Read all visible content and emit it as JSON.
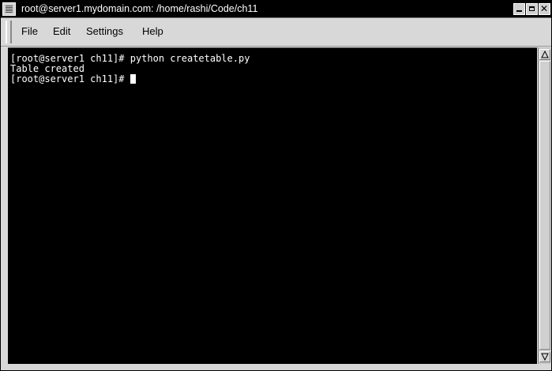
{
  "window": {
    "title": "root@server1.mydomain.com: /home/rashi/Code/ch11",
    "buttons": {
      "minimize_icon": "minimize-icon",
      "maximize_icon": "maximize-icon",
      "close_icon": "close-icon",
      "close_glyph": "✕"
    }
  },
  "menubar": {
    "items": [
      {
        "label": "File"
      },
      {
        "label": "Edit"
      },
      {
        "label": "Settings"
      },
      {
        "label": "Help"
      }
    ]
  },
  "terminal": {
    "background": "#000000",
    "foreground": "#ffffff",
    "lines": [
      "[root@server1 ch11]# python createtable.py",
      "Table created",
      "[root@server1 ch11]# "
    ]
  }
}
